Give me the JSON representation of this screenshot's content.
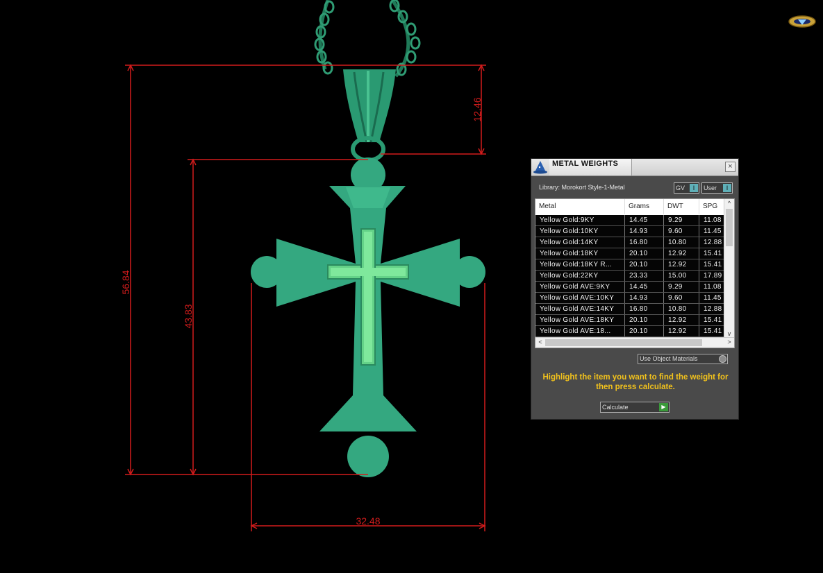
{
  "dimensions": {
    "total_height": "56.84",
    "body_height": "43.83",
    "bail_height": "12.46",
    "width": "32.48"
  },
  "colors": {
    "dimension_line": "#d21c1c",
    "pendant": "#2fa57a",
    "pendant_highlight": "#6fe08a",
    "hint_text": "#f2c21c"
  },
  "logo": {
    "icon": "diamond-logo-icon"
  },
  "panel": {
    "title": "METAL WEIGHTS",
    "title_icon": "wizard-hat-icon",
    "close_label": "×",
    "library": "Library: Morokort Style-1-Metal",
    "gv_label": "GV",
    "gv_indicator": "I",
    "user_label": "User",
    "user_indicator": "I",
    "columns": [
      "Metal",
      "Grams",
      "DWT",
      "SPG"
    ],
    "rows": [
      [
        "Yellow Gold:9KY",
        "14.45",
        "9.29",
        "11.08"
      ],
      [
        "Yellow Gold:10KY",
        "14.93",
        "9.60",
        "11.45"
      ],
      [
        "Yellow Gold:14KY",
        "16.80",
        "10.80",
        "12.88"
      ],
      [
        "Yellow Gold:18KY",
        "20.10",
        "12.92",
        "15.41"
      ],
      [
        "Yellow Gold:18KY R...",
        "20.10",
        "12.92",
        "15.41"
      ],
      [
        "Yellow Gold:22KY",
        "23.33",
        "15.00",
        "17.89"
      ],
      [
        "Yellow Gold AVE:9KY",
        "14.45",
        "9.29",
        "11.08"
      ],
      [
        "Yellow Gold AVE:10KY",
        "14.93",
        "9.60",
        "11.45"
      ],
      [
        "Yellow Gold AVE:14KY",
        "16.80",
        "10.80",
        "12.88"
      ],
      [
        "Yellow Gold AVE:18KY",
        "20.10",
        "12.92",
        "15.41"
      ],
      [
        "Yellow Gold AVE:18...",
        "20.10",
        "12.92",
        "15.41"
      ]
    ],
    "scroll_up": "^",
    "scroll_down": "v",
    "scroll_left": "<",
    "scroll_right": ">",
    "use_object_materials": "Use Object Materials",
    "hint": "Highlight the item you want to find the weight for then press calculate.",
    "calculate_label": "Calculate",
    "calculate_go": "▶"
  }
}
